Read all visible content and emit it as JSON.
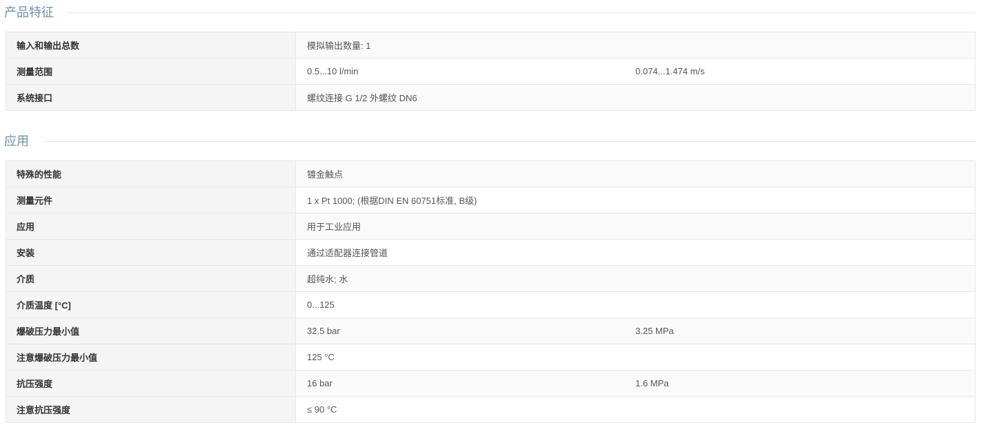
{
  "theme": {
    "heading_color": "#6f8fab"
  },
  "sections": [
    {
      "title": "产品特征",
      "rows": [
        {
          "label": "输入和输出总数",
          "values": [
            "模拟输出数量: 1"
          ]
        },
        {
          "label": "测量范围",
          "values": [
            "0.5...10 l/min",
            "0.074...1.474 m/s"
          ]
        },
        {
          "label": "系统接口",
          "values": [
            "螺纹连接 G 1/2 外螺纹 DN6"
          ]
        }
      ]
    },
    {
      "title": "应用",
      "rows": [
        {
          "label": "特殊的性能",
          "values": [
            "镀金触点"
          ]
        },
        {
          "label": "测量元件",
          "values": [
            "1 x Pt 1000; (根据DIN EN 60751标准, B级)"
          ]
        },
        {
          "label": "应用",
          "values": [
            "用于工业应用"
          ]
        },
        {
          "label": "安装",
          "values": [
            "通过适配器连接管道"
          ]
        },
        {
          "label": "介质",
          "values": [
            "超纯水; 水"
          ]
        },
        {
          "label": "介质温度 [°C]",
          "values": [
            "0...125"
          ]
        },
        {
          "label": "爆破压力最小值",
          "values": [
            "32.5 bar",
            "3.25 MPa"
          ]
        },
        {
          "label": "注意爆破压力最小值",
          "values": [
            "125 °C"
          ]
        },
        {
          "label": "抗压强度",
          "values": [
            "16 bar",
            "1.6 MPa"
          ]
        },
        {
          "label": "注意抗压强度",
          "values": [
            "≤ 90 °C"
          ]
        }
      ]
    }
  ]
}
